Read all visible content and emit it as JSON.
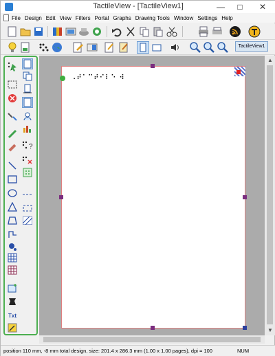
{
  "window": {
    "title": "TactileView - [TactileView1]",
    "minimize": "—",
    "maximize": "□",
    "close": "✕"
  },
  "menu": [
    "File",
    "Design",
    "Edit",
    "View",
    "Filters",
    "Portal",
    "Graphs",
    "Drawing Tools",
    "Window",
    "Settings",
    "Help"
  ],
  "toolbar1": {
    "icons": [
      "new-file-icon",
      "open-folder-icon",
      "save-icon",
      "book-icon",
      "library-icon",
      "scanner-icon",
      "gallery-icon",
      "undo-icon",
      "cut-icon",
      "copy-icon",
      "paste-icon",
      "scissors-icon",
      "print-icon",
      "printer-settings-icon",
      "rss-icon",
      "tactile-logo-icon"
    ]
  },
  "toolbar2": {
    "tab_label": "TactileView1",
    "icons": [
      "lightbulb-icon",
      "page-icon",
      "braille-dots-icon",
      "globe-icon",
      "edit-pencil-icon",
      "toggle-icon",
      "note-icon",
      "page-portrait-icon",
      "page-landscape-icon",
      "speaker-icon",
      "zoom-in-icon",
      "zoom-out-icon",
      "zoom-fit-icon"
    ]
  },
  "status": {
    "text": "position 110 mm, -8 mm total design, size: 201.4 x 286.3 mm (1.00 x 1.00 pages), dpi = 100",
    "num": "NUM"
  },
  "canvas": {
    "braille_text": "⠠⠞⠁⠉⠞⠊⠇⠑ ⠺"
  },
  "palette_text": {
    "txt_label": "Txt"
  }
}
